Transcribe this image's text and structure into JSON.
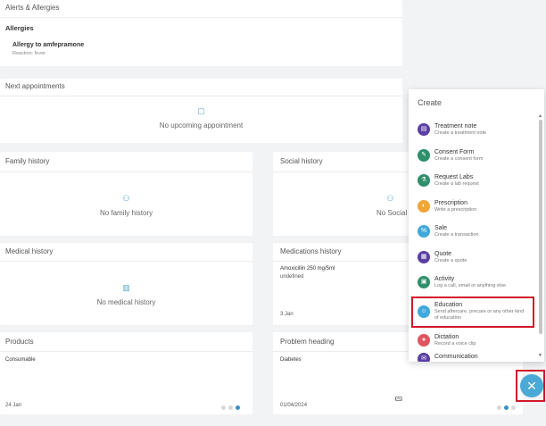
{
  "alerts": {
    "title": "Alerts & Allergies",
    "section": "Allergies",
    "allergy_name": "Allergy to amfepramone",
    "allergy_reaction": "Reaction: fever"
  },
  "appointments": {
    "title": "Next appointments",
    "empty_text": "No upcoming appointment"
  },
  "family_history": {
    "title": "Family history",
    "empty_text": "No family history"
  },
  "social_history": {
    "title": "Social history",
    "empty_text": "No Social h"
  },
  "medical_history": {
    "title": "Medical history",
    "empty_text": "No medical history"
  },
  "medications": {
    "title": "Medications history",
    "drug": "Amoxicillin 250 mg/5ml",
    "detail": "undefined",
    "date": "3 Jan"
  },
  "products": {
    "title": "Products",
    "item": "Consumable",
    "date": "24 Jan"
  },
  "problem": {
    "title": "Problem heading",
    "item": "Diabetes",
    "date": "01/04/2024"
  },
  "create_menu": {
    "title": "Create",
    "items": [
      {
        "label": "Treatment note",
        "desc": "Create a treatment note",
        "icon": "document-icon",
        "color": "#5b3fa3",
        "glyph": "▤"
      },
      {
        "label": "Consent Form",
        "desc": "Create a consent form",
        "icon": "pen-icon",
        "color": "#2f8f6a",
        "glyph": "✎"
      },
      {
        "label": "Request Labs",
        "desc": "Create a lab request",
        "icon": "flask-icon",
        "color": "#2f8f6a",
        "glyph": "⚗"
      },
      {
        "label": "Prescription",
        "desc": "Write a prescription",
        "icon": "pill-icon",
        "color": "#f0a637",
        "glyph": "◐"
      },
      {
        "label": "Sale",
        "desc": "Create a transaction",
        "icon": "tag-icon",
        "color": "#3fa9dc",
        "glyph": "%"
      },
      {
        "label": "Quote",
        "desc": "Create a quote",
        "icon": "calculator-icon",
        "color": "#5b3fa3",
        "glyph": "▦"
      },
      {
        "label": "Activity",
        "desc": "Log a call, email or anything else",
        "icon": "calendar-icon",
        "color": "#2f8f6a",
        "glyph": "▣"
      },
      {
        "label": "Education",
        "desc": "Send aftercare, precare or any other kind of education",
        "icon": "education-icon",
        "color": "#3fa9dc",
        "glyph": "☺"
      },
      {
        "label": "Dictation",
        "desc": "Record a voice clip",
        "icon": "microphone-icon",
        "color": "#e2545f",
        "glyph": "●"
      },
      {
        "label": "Communication",
        "desc": "",
        "icon": "chat-icon",
        "color": "#5b3fa3",
        "glyph": "✉"
      }
    ]
  },
  "fab": {
    "glyph": "✕"
  }
}
